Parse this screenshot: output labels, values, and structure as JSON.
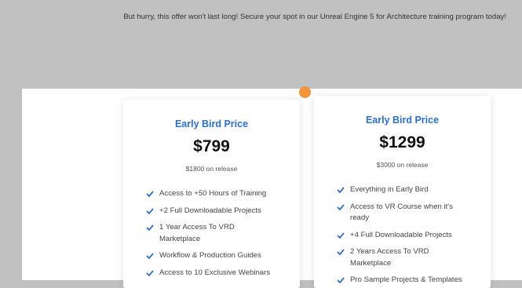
{
  "promo_text": "But hurry, this offer won't last long! Secure your spot in our Unreal Engine 5 for Architecture training program today!",
  "colors": {
    "accent": "#2a6fd1",
    "dot": "#f3953a",
    "page_bg": "#c1c1c1"
  },
  "cards": [
    {
      "title": "Early Bird Price",
      "price": "$799",
      "release": "$1800 on release",
      "features": [
        "Access to +50 Hours of Training",
        "+2 Full Downloadable Projects",
        "1 Year Access To VRD Marketplace",
        "Workflow & Production Guides",
        "Access to 10 Exclusive Webinars"
      ]
    },
    {
      "title": "Early Bird Price",
      "price": "$1299",
      "release": "$3000 on release",
      "features": [
        "Everything in Early Bird",
        "Access to VR Course when it's ready",
        "+4 Full Downloadable Projects",
        "2 Years Access To VRD Marketplace",
        "Pro Sample Projects & Templates"
      ]
    }
  ]
}
